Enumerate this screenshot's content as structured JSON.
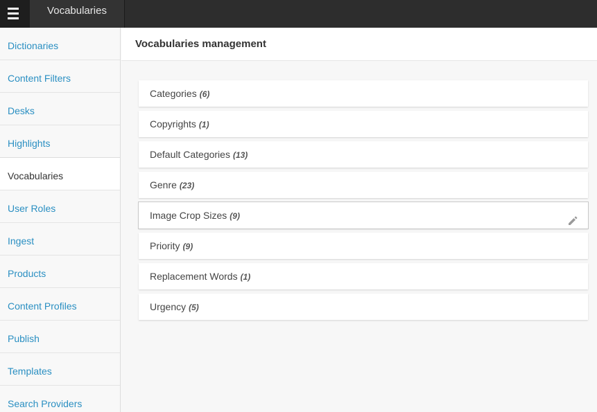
{
  "topbar": {
    "title": "Vocabularies",
    "menu_icon": "hamburger-icon"
  },
  "sidebar": {
    "items": [
      {
        "label": "Dictionaries"
      },
      {
        "label": "Content Filters"
      },
      {
        "label": "Desks"
      },
      {
        "label": "Highlights"
      },
      {
        "label": "Vocabularies",
        "active": true
      },
      {
        "label": "User Roles"
      },
      {
        "label": "Ingest"
      },
      {
        "label": "Products"
      },
      {
        "label": "Content Profiles"
      },
      {
        "label": "Publish"
      },
      {
        "label": "Templates"
      },
      {
        "label": "Search Providers"
      }
    ]
  },
  "main": {
    "title": "Vocabularies management",
    "vocabularies": [
      {
        "name": "Categories",
        "count": "(6)"
      },
      {
        "name": "Copyrights",
        "count": "(1)"
      },
      {
        "name": "Default Categories",
        "count": "(13)"
      },
      {
        "name": "Genre",
        "count": "(23)"
      },
      {
        "name": "Image Crop Sizes",
        "count": "(9)",
        "hovered": true,
        "action_icon": "pencil-icon"
      },
      {
        "name": "Priority",
        "count": "(9)"
      },
      {
        "name": "Replacement Words",
        "count": "(1)"
      },
      {
        "name": "Urgency",
        "count": "(5)"
      }
    ]
  },
  "colors": {
    "topbar_bg": "#2d2d2d",
    "link": "#2a8fc2",
    "text": "#333333",
    "page_bg": "#f7f7f7"
  }
}
